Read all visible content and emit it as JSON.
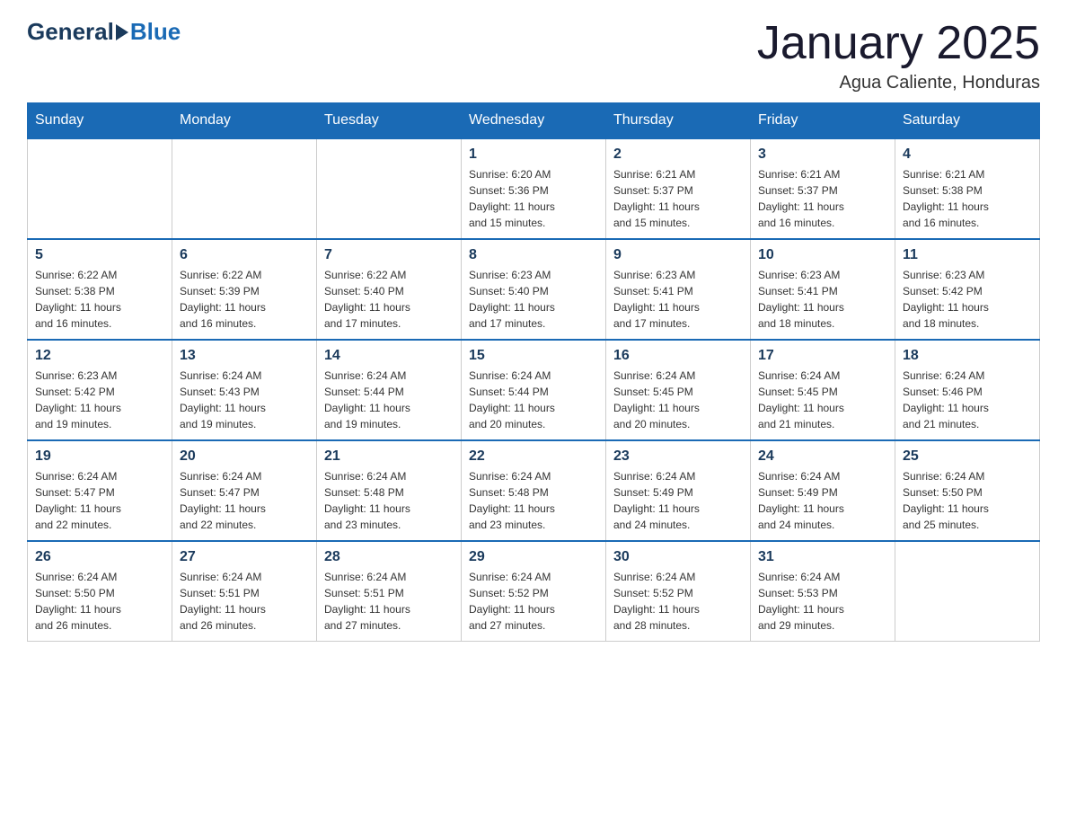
{
  "logo": {
    "general": "General",
    "blue": "Blue"
  },
  "title": "January 2025",
  "location": "Agua Caliente, Honduras",
  "days_of_week": [
    "Sunday",
    "Monday",
    "Tuesday",
    "Wednesday",
    "Thursday",
    "Friday",
    "Saturday"
  ],
  "weeks": [
    [
      {
        "day": "",
        "info": ""
      },
      {
        "day": "",
        "info": ""
      },
      {
        "day": "",
        "info": ""
      },
      {
        "day": "1",
        "info": "Sunrise: 6:20 AM\nSunset: 5:36 PM\nDaylight: 11 hours\nand 15 minutes."
      },
      {
        "day": "2",
        "info": "Sunrise: 6:21 AM\nSunset: 5:37 PM\nDaylight: 11 hours\nand 15 minutes."
      },
      {
        "day": "3",
        "info": "Sunrise: 6:21 AM\nSunset: 5:37 PM\nDaylight: 11 hours\nand 16 minutes."
      },
      {
        "day": "4",
        "info": "Sunrise: 6:21 AM\nSunset: 5:38 PM\nDaylight: 11 hours\nand 16 minutes."
      }
    ],
    [
      {
        "day": "5",
        "info": "Sunrise: 6:22 AM\nSunset: 5:38 PM\nDaylight: 11 hours\nand 16 minutes."
      },
      {
        "day": "6",
        "info": "Sunrise: 6:22 AM\nSunset: 5:39 PM\nDaylight: 11 hours\nand 16 minutes."
      },
      {
        "day": "7",
        "info": "Sunrise: 6:22 AM\nSunset: 5:40 PM\nDaylight: 11 hours\nand 17 minutes."
      },
      {
        "day": "8",
        "info": "Sunrise: 6:23 AM\nSunset: 5:40 PM\nDaylight: 11 hours\nand 17 minutes."
      },
      {
        "day": "9",
        "info": "Sunrise: 6:23 AM\nSunset: 5:41 PM\nDaylight: 11 hours\nand 17 minutes."
      },
      {
        "day": "10",
        "info": "Sunrise: 6:23 AM\nSunset: 5:41 PM\nDaylight: 11 hours\nand 18 minutes."
      },
      {
        "day": "11",
        "info": "Sunrise: 6:23 AM\nSunset: 5:42 PM\nDaylight: 11 hours\nand 18 minutes."
      }
    ],
    [
      {
        "day": "12",
        "info": "Sunrise: 6:23 AM\nSunset: 5:42 PM\nDaylight: 11 hours\nand 19 minutes."
      },
      {
        "day": "13",
        "info": "Sunrise: 6:24 AM\nSunset: 5:43 PM\nDaylight: 11 hours\nand 19 minutes."
      },
      {
        "day": "14",
        "info": "Sunrise: 6:24 AM\nSunset: 5:44 PM\nDaylight: 11 hours\nand 19 minutes."
      },
      {
        "day": "15",
        "info": "Sunrise: 6:24 AM\nSunset: 5:44 PM\nDaylight: 11 hours\nand 20 minutes."
      },
      {
        "day": "16",
        "info": "Sunrise: 6:24 AM\nSunset: 5:45 PM\nDaylight: 11 hours\nand 20 minutes."
      },
      {
        "day": "17",
        "info": "Sunrise: 6:24 AM\nSunset: 5:45 PM\nDaylight: 11 hours\nand 21 minutes."
      },
      {
        "day": "18",
        "info": "Sunrise: 6:24 AM\nSunset: 5:46 PM\nDaylight: 11 hours\nand 21 minutes."
      }
    ],
    [
      {
        "day": "19",
        "info": "Sunrise: 6:24 AM\nSunset: 5:47 PM\nDaylight: 11 hours\nand 22 minutes."
      },
      {
        "day": "20",
        "info": "Sunrise: 6:24 AM\nSunset: 5:47 PM\nDaylight: 11 hours\nand 22 minutes."
      },
      {
        "day": "21",
        "info": "Sunrise: 6:24 AM\nSunset: 5:48 PM\nDaylight: 11 hours\nand 23 minutes."
      },
      {
        "day": "22",
        "info": "Sunrise: 6:24 AM\nSunset: 5:48 PM\nDaylight: 11 hours\nand 23 minutes."
      },
      {
        "day": "23",
        "info": "Sunrise: 6:24 AM\nSunset: 5:49 PM\nDaylight: 11 hours\nand 24 minutes."
      },
      {
        "day": "24",
        "info": "Sunrise: 6:24 AM\nSunset: 5:49 PM\nDaylight: 11 hours\nand 24 minutes."
      },
      {
        "day": "25",
        "info": "Sunrise: 6:24 AM\nSunset: 5:50 PM\nDaylight: 11 hours\nand 25 minutes."
      }
    ],
    [
      {
        "day": "26",
        "info": "Sunrise: 6:24 AM\nSunset: 5:50 PM\nDaylight: 11 hours\nand 26 minutes."
      },
      {
        "day": "27",
        "info": "Sunrise: 6:24 AM\nSunset: 5:51 PM\nDaylight: 11 hours\nand 26 minutes."
      },
      {
        "day": "28",
        "info": "Sunrise: 6:24 AM\nSunset: 5:51 PM\nDaylight: 11 hours\nand 27 minutes."
      },
      {
        "day": "29",
        "info": "Sunrise: 6:24 AM\nSunset: 5:52 PM\nDaylight: 11 hours\nand 27 minutes."
      },
      {
        "day": "30",
        "info": "Sunrise: 6:24 AM\nSunset: 5:52 PM\nDaylight: 11 hours\nand 28 minutes."
      },
      {
        "day": "31",
        "info": "Sunrise: 6:24 AM\nSunset: 5:53 PM\nDaylight: 11 hours\nand 29 minutes."
      },
      {
        "day": "",
        "info": ""
      }
    ]
  ]
}
